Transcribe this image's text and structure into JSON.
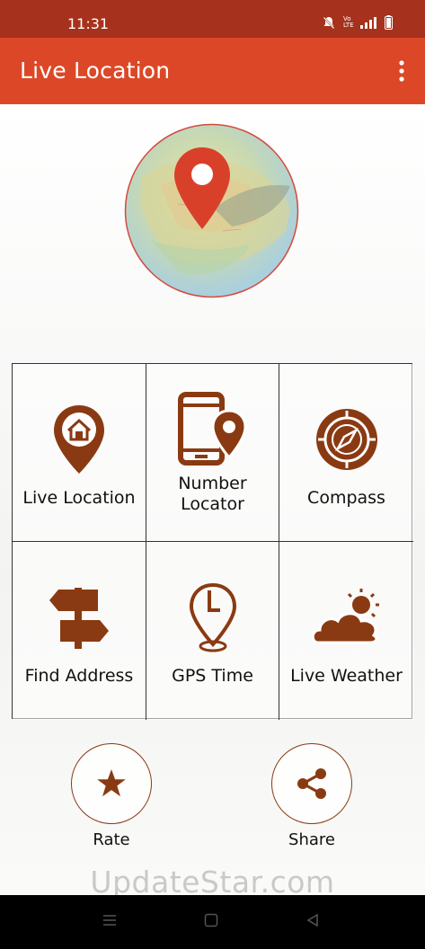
{
  "status_bar": {
    "time": "11:31",
    "network_label": "Vo LTE"
  },
  "app_bar": {
    "title": "Live Location",
    "menu_icon": "more-vertical-icon"
  },
  "hero": {
    "icon": "globe-map-pin-icon"
  },
  "grid": {
    "items": [
      {
        "label": "Live Location",
        "icon": "home-pin-icon"
      },
      {
        "label": "Number Locator",
        "line1": "Number",
        "line2": "Locator",
        "icon": "phone-pin-icon"
      },
      {
        "label": "Compass",
        "icon": "compass-icon"
      },
      {
        "label": "Find Address",
        "icon": "signpost-icon"
      },
      {
        "label": "GPS Time",
        "icon": "clock-pin-icon"
      },
      {
        "label": "Live Weather",
        "icon": "sun-cloud-icon"
      }
    ]
  },
  "actions": {
    "rate": {
      "label": "Rate",
      "icon": "star-icon"
    },
    "share": {
      "label": "Share",
      "icon": "share-icon"
    }
  },
  "watermark": "UpdateStar.com",
  "colors": {
    "status_bar": "#a6321d",
    "app_bar": "#dc4827",
    "icon_brown": "#8a3a12",
    "pin_red": "#d9402a"
  }
}
